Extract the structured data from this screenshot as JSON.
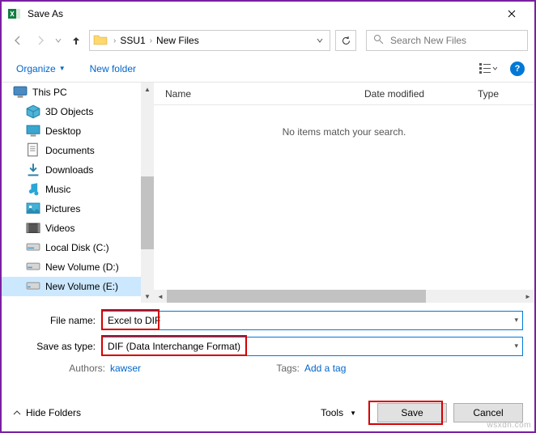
{
  "window": {
    "title": "Save As"
  },
  "nav": {
    "crumb1": "SSU1",
    "crumb2": "New Files",
    "search_placeholder": "Search New Files"
  },
  "toolbar": {
    "organize": "Organize",
    "newfolder": "New folder"
  },
  "tree": {
    "root": "This PC",
    "items": [
      "3D Objects",
      "Desktop",
      "Documents",
      "Downloads",
      "Music",
      "Pictures",
      "Videos",
      "Local Disk (C:)",
      "New Volume (D:)",
      "New Volume (E:)"
    ]
  },
  "columns": {
    "name": "Name",
    "date": "Date modified",
    "type": "Type"
  },
  "empty_msg": "No items match your search.",
  "form": {
    "filename_label": "File name:",
    "filename_value": "Excel to DIF",
    "type_label": "Save as type:",
    "type_value": "DIF (Data Interchange Format)",
    "authors_label": "Authors:",
    "authors_value": "kawser",
    "tags_label": "Tags:",
    "tags_value": "Add a tag"
  },
  "footer": {
    "hide": "Hide Folders",
    "tools": "Tools",
    "save": "Save",
    "cancel": "Cancel"
  },
  "watermark": "wsxdn.com",
  "colors": {
    "accent": "#0078d7",
    "highlight_red": "#d40000",
    "link": "#0066cc"
  }
}
